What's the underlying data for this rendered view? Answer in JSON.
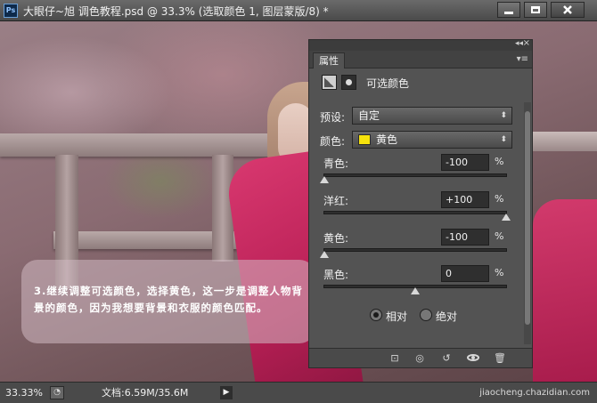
{
  "window": {
    "logo_text": "Ps",
    "title": "大眼仔~旭 调色教程.psd @ 33.3% (选取颜色 1, 图层蒙版/8) *"
  },
  "annotation": {
    "text": "3.继续调整可选颜色，选择黄色，这一步是调整人物背景的颜色，因为我想要背景和衣服的颜色匹配。"
  },
  "panel": {
    "tab_label": "属性",
    "adjustment_title": "可选颜色",
    "preset": {
      "label": "预设:",
      "value": "自定"
    },
    "colors": {
      "label": "颜色:",
      "value": "黄色",
      "swatch_color": "#f6e20c"
    },
    "sliders": [
      {
        "label": "青色:",
        "value": "-100",
        "unit": "%",
        "level": -100
      },
      {
        "label": "洋红:",
        "value": "+100",
        "unit": "%",
        "level": 100
      },
      {
        "label": "黄色:",
        "value": "-100",
        "unit": "%",
        "level": -100
      },
      {
        "label": "黑色:",
        "value": "0",
        "unit": "%",
        "level": 0
      }
    ],
    "method": {
      "relative_label": "相对",
      "absolute_label": "绝对",
      "selected": "relative"
    }
  },
  "statusbar": {
    "zoom": "33.33%",
    "doc_info": "文档:6.59M/35.6M",
    "watermark": "jiaocheng.chazidian.com"
  }
}
